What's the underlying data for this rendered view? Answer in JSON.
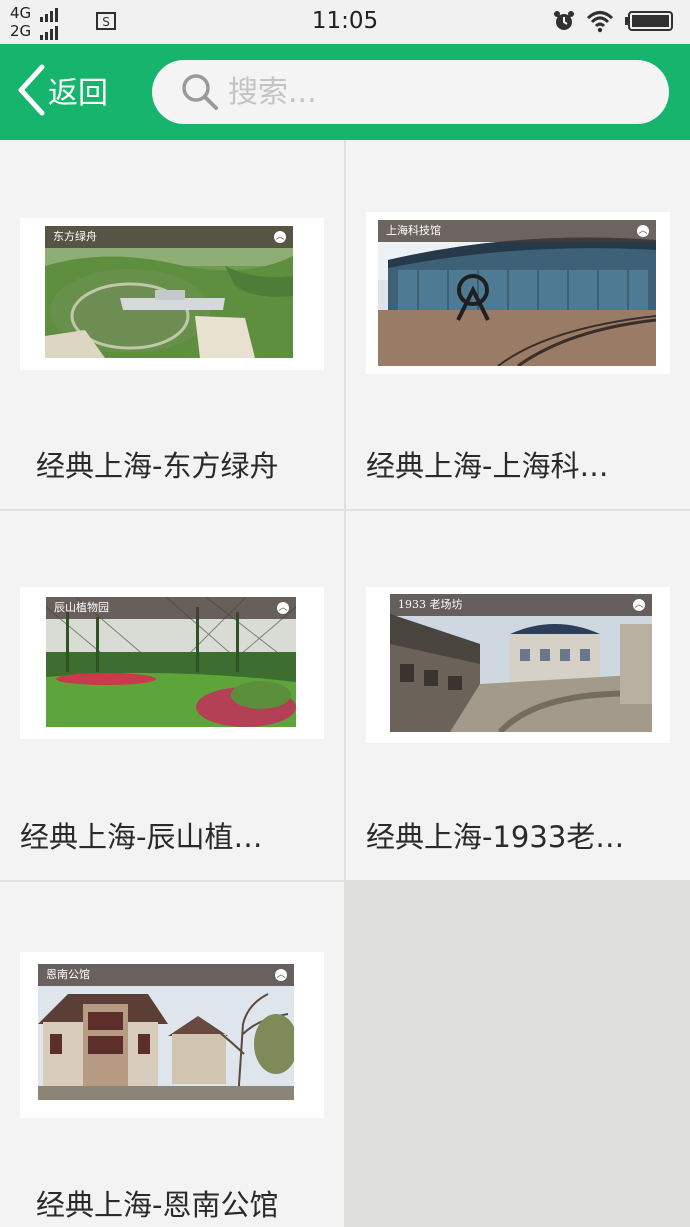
{
  "status_bar": {
    "network_top": "4G",
    "network_bottom": "2G",
    "time": "11:05"
  },
  "header": {
    "back_label": "返回",
    "search_placeholder": "搜索..."
  },
  "items": [
    {
      "title": "经典上海-东方绿舟",
      "banner": "东方绿舟"
    },
    {
      "title": "经典上海-上海科…",
      "banner": "上海科技馆"
    },
    {
      "title": "经典上海-辰山植…",
      "banner": "辰山植物园"
    },
    {
      "title": "经典上海-1933老…",
      "banner": "1933 老场坊"
    },
    {
      "title": "经典上海-恩南公馆",
      "banner": "恩南公馆"
    }
  ],
  "colors": {
    "header": "#16b46c",
    "cell": "#f3f3f3",
    "empty_area": "#dfdfdd"
  }
}
